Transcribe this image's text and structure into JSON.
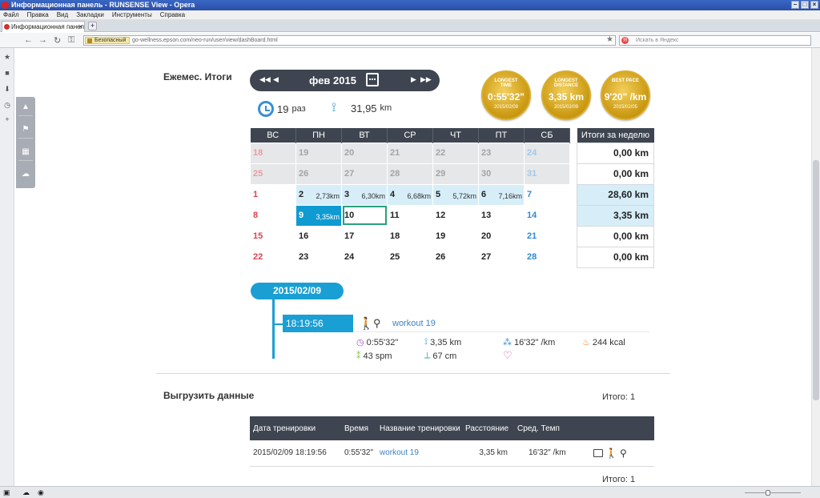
{
  "browser": {
    "title": "Информационная панель - RUNSENSE View - Opera",
    "menu": [
      "Файл",
      "Правка",
      "Вид",
      "Закладки",
      "Инструменты",
      "Справка"
    ],
    "tab_label": "Информационная панел...",
    "secure_label": "Безопасный",
    "url": "go-wellness.epson.com/neo-run/user/view/dashBoard.html",
    "search_placeholder": "Искать в Яндекс"
  },
  "monthly": {
    "heading": "Ежемес. Итоги",
    "month_label": "фев 2015",
    "count_value": "19",
    "count_unit": "раз",
    "distance_value": "31,95",
    "distance_unit": "km"
  },
  "medals": [
    {
      "title": "LONGEST TIME",
      "value": "0:55'32\"",
      "date": "2015/02/09"
    },
    {
      "title": "LONGEST DISTANCE",
      "value": "3,35 km",
      "date": "2015/02/09"
    },
    {
      "title": "BEST PACE",
      "value": "9'20\" /km",
      "date": "2015/02/05"
    }
  ],
  "calendar": {
    "weekdays": [
      "ВС",
      "ПН",
      "ВТ",
      "СР",
      "ЧТ",
      "ПТ",
      "СБ"
    ],
    "weeks": [
      [
        {
          "d": "18"
        },
        {
          "d": "19"
        },
        {
          "d": "20"
        },
        {
          "d": "21"
        },
        {
          "d": "22"
        },
        {
          "d": "23"
        },
        {
          "d": "24"
        }
      ],
      [
        {
          "d": "25"
        },
        {
          "d": "26"
        },
        {
          "d": "27"
        },
        {
          "d": "28"
        },
        {
          "d": "29"
        },
        {
          "d": "30"
        },
        {
          "d": "31"
        }
      ],
      [
        {
          "d": "1"
        },
        {
          "d": "2",
          "km": "2,73km"
        },
        {
          "d": "3",
          "km": "6,30km"
        },
        {
          "d": "4",
          "km": "6,68km"
        },
        {
          "d": "5",
          "km": "5,72km"
        },
        {
          "d": "6",
          "km": "7,16km"
        },
        {
          "d": "7"
        }
      ],
      [
        {
          "d": "8"
        },
        {
          "d": "9",
          "km": "3,35km"
        },
        {
          "d": "10"
        },
        {
          "d": "11"
        },
        {
          "d": "12"
        },
        {
          "d": "13"
        },
        {
          "d": "14"
        }
      ],
      [
        {
          "d": "15"
        },
        {
          "d": "16"
        },
        {
          "d": "17"
        },
        {
          "d": "18"
        },
        {
          "d": "19"
        },
        {
          "d": "20"
        },
        {
          "d": "21"
        }
      ],
      [
        {
          "d": "22"
        },
        {
          "d": "23"
        },
        {
          "d": "24"
        },
        {
          "d": "25"
        },
        {
          "d": "26"
        },
        {
          "d": "27"
        },
        {
          "d": "28"
        }
      ]
    ]
  },
  "weekly": {
    "header": "Итоги за неделю",
    "values": [
      "0,00 km",
      "0,00 km",
      "28,60 km",
      "3,35 km",
      "0,00 km",
      "0,00 km"
    ]
  },
  "timeline": {
    "date": "2015/02/09",
    "time": "18:19:56",
    "workout_name": "workout 19",
    "duration": "0:55'32\"",
    "distance": "3,35 km",
    "pace": "16'32\" /km",
    "calories": "244 kcal",
    "cadence": "43 spm",
    "stride": "67 cm"
  },
  "export": {
    "heading": "Выгрузить данные",
    "total_label": "Итого: 1",
    "columns": [
      "Дата тренировки",
      "Время",
      "Название тренировки",
      "Расстояние",
      "Сред. Темп"
    ],
    "rows": [
      {
        "date": "2015/02/09 18:19:56",
        "time": "0:55'32\"",
        "name": "workout 19",
        "distance": "3,35 km",
        "pace": "16'32\" /km"
      }
    ]
  },
  "colors": {
    "accent": "#1a9fd4",
    "header_dark": "#3e4550",
    "sunday": "#d74551",
    "saturday": "#2f8ad0",
    "gold": "#c99710"
  }
}
